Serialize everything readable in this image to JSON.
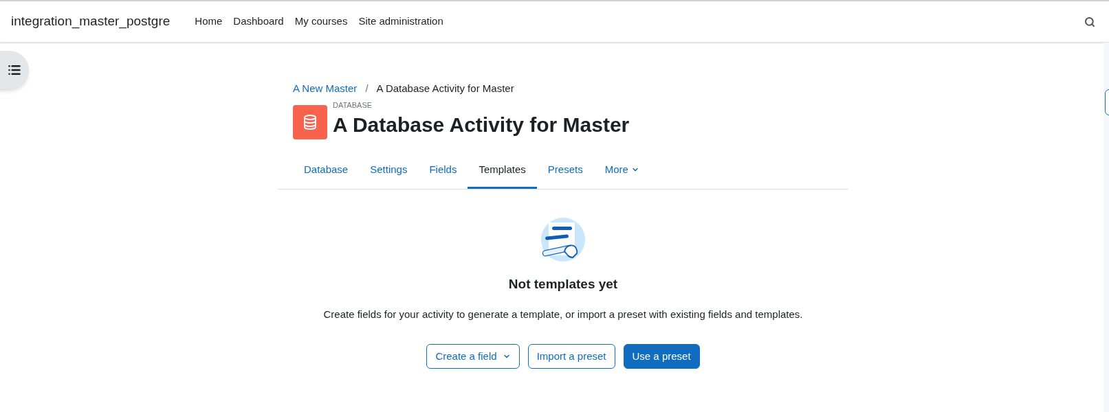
{
  "header": {
    "site_name": "integration_master_postgre",
    "nav": [
      "Home",
      "Dashboard",
      "My courses",
      "Site administration"
    ]
  },
  "breadcrumb": [
    "A New Master",
    "A Database Activity for Master"
  ],
  "breadcrumb_separator": "/",
  "activity": {
    "type_label": "DATABASE",
    "title": "A Database Activity for Master"
  },
  "tabs": [
    {
      "label": "Database",
      "selected": false,
      "kind": "link"
    },
    {
      "label": "Settings",
      "selected": false,
      "kind": "link"
    },
    {
      "label": "Fields",
      "selected": false,
      "kind": "link"
    },
    {
      "label": "Templates",
      "selected": true,
      "kind": "link"
    },
    {
      "label": "Presets",
      "selected": false,
      "kind": "link"
    },
    {
      "label": "More",
      "selected": false,
      "kind": "dropdown"
    }
  ],
  "empty_state": {
    "heading": "Not templates yet",
    "message": "Create fields for your activity to generate a template, or import a preset with existing fields and templates."
  },
  "buttons": [
    {
      "label": "Create a field",
      "kind": "dropdown"
    },
    {
      "label": "Import a preset",
      "kind": "outline"
    },
    {
      "label": "Use a preset",
      "kind": "primary"
    }
  ]
}
